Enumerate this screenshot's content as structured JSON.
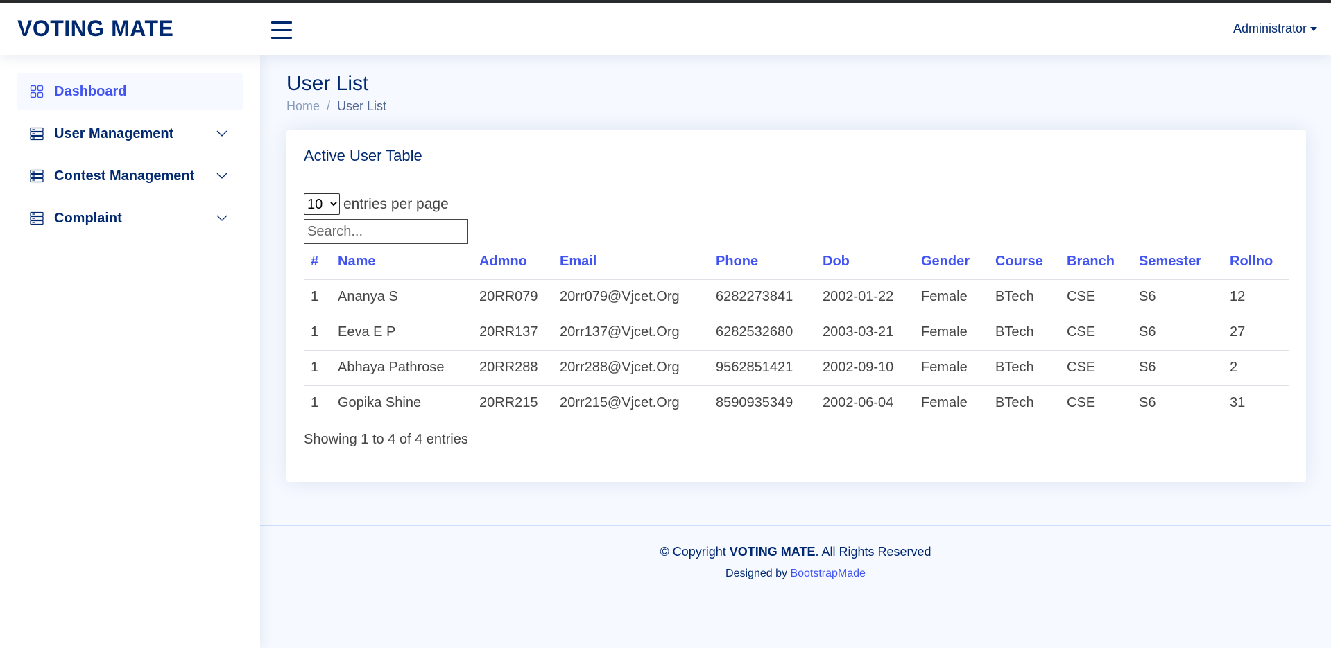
{
  "header": {
    "logo": "VOTING MATE",
    "user_menu": "Administrator"
  },
  "sidebar": {
    "items": [
      {
        "label": "Dashboard",
        "icon": "grid-icon",
        "active": true
      },
      {
        "label": "User Management",
        "icon": "server-icon"
      },
      {
        "label": "Contest Management",
        "icon": "server-icon"
      },
      {
        "label": "Complaint",
        "icon": "server-icon"
      }
    ]
  },
  "page": {
    "title": "User List",
    "breadcrumb": {
      "home": "Home",
      "separator": "/",
      "current": "User List"
    }
  },
  "card": {
    "title": "Active User Table",
    "per_page_value": "10",
    "per_page_label": "entries per page",
    "search_placeholder": "Search...",
    "footer_info": "Showing 1 to 4 of 4 entries"
  },
  "table": {
    "headers": [
      "#",
      "Name",
      "Admno",
      "Email",
      "Phone",
      "Dob",
      "Gender",
      "Course",
      "Branch",
      "Semester",
      "Rollno"
    ],
    "rows": [
      [
        "1",
        "Ananya S",
        "20RR079",
        "20rr079@Vjcet.Org",
        "6282273841",
        "2002-01-22",
        "Female",
        "BTech",
        "CSE",
        "S6",
        "12"
      ],
      [
        "1",
        "Eeva E P",
        "20RR137",
        "20rr137@Vjcet.Org",
        "6282532680",
        "2003-03-21",
        "Female",
        "BTech",
        "CSE",
        "S6",
        "27"
      ],
      [
        "1",
        "Abhaya Pathrose",
        "20RR288",
        "20rr288@Vjcet.Org",
        "9562851421",
        "2002-09-10",
        "Female",
        "BTech",
        "CSE",
        "S6",
        "2"
      ],
      [
        "1",
        "Gopika Shine",
        "20RR215",
        "20rr215@Vjcet.Org",
        "8590935349",
        "2002-06-04",
        "Female",
        "BTech",
        "CSE",
        "S6",
        "31"
      ]
    ]
  },
  "footer": {
    "copyright_prefix": "© Copyright",
    "copyright_brand": "VOTING MATE",
    "copyright_suffix": ". All Rights Reserved",
    "designed_by": "Designed by",
    "designer_link": "BootstrapMade"
  },
  "colors": {
    "primary": "#4154f1",
    "navy": "#012970",
    "background": "#f6f9ff"
  }
}
